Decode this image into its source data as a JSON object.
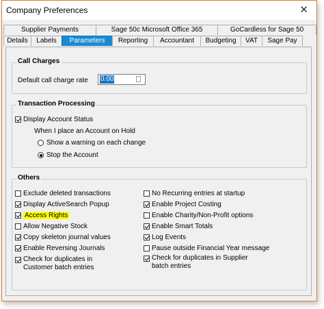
{
  "window": {
    "title": "Company Preferences",
    "close_glyph": "✕"
  },
  "tabs_row1": [
    {
      "label": "Supplier Payments"
    },
    {
      "label": "Sage 50c Microsoft Office 365"
    },
    {
      "label": "GoCardless for Sage 50"
    }
  ],
  "tabs_row2": [
    {
      "label": "Details"
    },
    {
      "label": "Labels"
    },
    {
      "label": "Parameters",
      "active": true
    },
    {
      "label": "Reporting"
    },
    {
      "label": "Accountant"
    },
    {
      "label": "Budgeting"
    },
    {
      "label": "VAT"
    },
    {
      "label": "Sage Pay"
    }
  ],
  "call_charges": {
    "legend": "Call Charges",
    "rate_label": "Default call charge rate",
    "rate_value": "0.00"
  },
  "transaction_processing": {
    "legend": "Transaction Processing",
    "display_status_label": "Display Account Status",
    "display_status_checked": true,
    "on_hold_label": "When I place an Account on Hold",
    "options": [
      {
        "label": "Show a warning on each change",
        "selected": false
      },
      {
        "label": "Stop the Account",
        "selected": true
      }
    ]
  },
  "others": {
    "legend": "Others",
    "left": [
      {
        "label": "Exclude deleted transactions",
        "checked": false
      },
      {
        "label": "Display ActiveSearch Popup",
        "checked": true
      },
      {
        "label": "Access Rights",
        "checked": true,
        "highlight": true
      },
      {
        "label": "Allow Negative Stock",
        "checked": false
      },
      {
        "label": "Copy skeleton journal values",
        "checked": true
      },
      {
        "label": "Enable Reversing Journals",
        "checked": true
      },
      {
        "label": "Check for duplicates in",
        "label2": "Customer batch entries",
        "checked": true
      }
    ],
    "right": [
      {
        "label": "No Recurring entries at startup",
        "checked": false
      },
      {
        "label": "Enable Project Costing",
        "checked": true
      },
      {
        "label": "Enable Charity/Non-Profit options",
        "checked": false
      },
      {
        "label": "Enable Smart Totals",
        "checked": true
      },
      {
        "label": "Log Events",
        "checked": true
      },
      {
        "label": "Pause outside Financial Year message",
        "checked": false
      },
      {
        "label": "Check for duplicates in Supplier",
        "label2": "batch entries",
        "checked": true
      }
    ]
  },
  "colors": {
    "accent": "#1b8ad1",
    "window_border": "#e07b2a",
    "highlight": "#ffff00"
  }
}
